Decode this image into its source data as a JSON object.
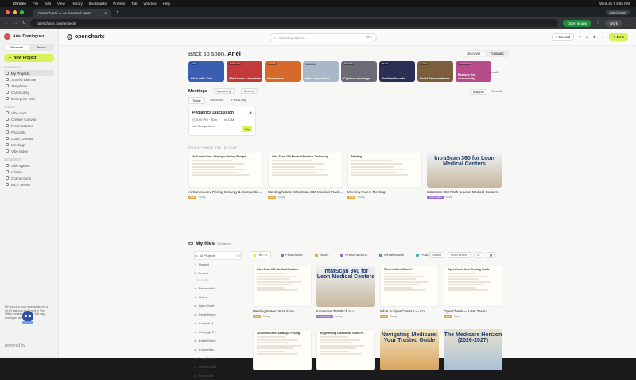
{
  "macbar": {
    "app": "Chrome",
    "menus": [
      "File",
      "Edit",
      "View",
      "History",
      "Bookmarks",
      "Profiles",
      "Tab",
      "Window",
      "Help"
    ],
    "clock": "Wed Jul 9 6:56 PM"
  },
  "browser": {
    "tab_title": "OpenCharts — AI-Powered Meeti...",
    "url": "opencharts.com/projects",
    "open_in_app": "Open in app",
    "ask": "Ask Gemini",
    "work": "Work"
  },
  "sidebar": {
    "user": "Ariel Dominguez",
    "seg": [
      "Personal",
      "Teams"
    ],
    "new_project": "New Project",
    "workspace_label": "WORKSPACE",
    "workspace": [
      "My Projects",
      "Shared with Me",
      "Templates",
      "Community",
      "Enterprise Wiki"
    ],
    "create_label": "CREATE",
    "create": [
      "Vibe docs",
      "Creator Canvas",
      "Presentations",
      "Podcasts",
      "Code Canvas",
      "Meetings",
      "Vibe Index"
    ],
    "connect_label": "GET AGENTS",
    "connect": [
      "Vibe agents",
      "Library",
      "Connections",
      "MCP Server"
    ],
    "promo": "My whack-a-mole sidebar launch at 20:00 just now as Gemini in The Office-watching Anant's 100-day developed arrived.",
    "powered": "powered by"
  },
  "topnav": {
    "logo": "opencharts",
    "search_placeholder": "Search projects...",
    "shortcut": "⌘K",
    "record": "Record",
    "new": "New"
  },
  "home": {
    "welcome_prefix": "Back so soon, ",
    "welcome_name": "Ariel",
    "discover": "Discover",
    "tutorials": "Tutorials",
    "templates": [
      {
        "label": "Chat with Tina",
        "tag": "NEW",
        "color": "#3a5fb0"
      },
      {
        "label": "Start from a template",
        "tag": "TEMPLATE",
        "color": "#c23b3b"
      },
      {
        "label": "Generate a...",
        "tag": "CREATE",
        "color": "#d76a2b"
      },
      {
        "label": "Make a podcast",
        "tag": "PODCAST",
        "color": "#a9b8c9"
      },
      {
        "label": "Capture meetings",
        "tag": "MEETING",
        "color": "#6d6a77"
      },
      {
        "label": "Build with code",
        "tag": "BUILD",
        "color": "#2a2f55"
      },
      {
        "label": "Build Presentations",
        "tag": "SLIDES",
        "color": "#7b5e3b"
      },
      {
        "label": "Explore the community",
        "tag": "COMMUNITY",
        "color": "#b84c8a"
      }
    ],
    "show_all": "Show all",
    "meetings_title": "Meetings",
    "upcoming": "Upcoming",
    "recent": "Recent",
    "meeting_tabs": [
      "Today",
      "Tomorrow",
      "Pick a day"
    ],
    "insights": "Insights",
    "view_all": "View All",
    "meeting": {
      "title": "Pediatrics Discussion",
      "time": "5:00 PM · 30m",
      "people": "In 12M",
      "source": "via Google Meet",
      "join": "Join"
    },
    "pickup": "PICK UP WHERE YOU LEFT OFF",
    "recent_cards": [
      {
        "head": "AirControl.dev: Strategic Pricing Bluepri...",
        "title": "AirControl.dev Pricing Strategy & Competitio...",
        "badge": "Note",
        "when": "Today"
      },
      {
        "head": "Intra Scan 360 Medical Practice Technolog...",
        "title": "Meeting Notes: Intra Scan 360 Medical Practi...",
        "badge": "Note",
        "when": "Today"
      },
      {
        "head": "Meeting",
        "title": "Meeting Notes: Meeting",
        "badge": "Note",
        "when": "Today"
      },
      {
        "head": "IntraScan 360 for Leon Medical Centers",
        "title": "IntraScan 360 Pitch to Leon Medical Centers",
        "badge": "Presentation",
        "when": "Today"
      }
    ]
  },
  "files": {
    "title": "My files",
    "count": "200 items",
    "tree": [
      {
        "label": "All Projects",
        "n": "200"
      },
      {
        "label": "Starred",
        "n": ""
      },
      {
        "label": "Recent",
        "n": ""
      },
      {
        "label": "FOLDERS",
        "n": ""
      },
      {
        "label": "Presentatio...",
        "n": ""
      },
      {
        "label": "Notes",
        "n": ""
      },
      {
        "label": "OpenChart...",
        "n": ""
      },
      {
        "label": "Study Notes",
        "n": ""
      },
      {
        "label": "Content M...",
        "n": ""
      },
      {
        "label": "Strategy/ P...",
        "n": ""
      },
      {
        "label": "Briefs Notes",
        "n": ""
      },
      {
        "label": "Competitiv...",
        "n": ""
      },
      {
        "label": "Script Notes",
        "n": ""
      },
      {
        "label": "Whiteboards",
        "n": ""
      },
      {
        "label": "Flowcharts",
        "n": ""
      }
    ],
    "filters": [
      {
        "label": "All",
        "n": "200",
        "c": "#d7f25a"
      },
      {
        "label": "Flowcharts",
        "n": "",
        "c": "#8a6ad8"
      },
      {
        "label": "Notes",
        "n": "",
        "c": "#e8a33c"
      },
      {
        "label": "Presentations",
        "n": "",
        "c": "#9b6ad8"
      },
      {
        "label": "Whiteboards",
        "n": "",
        "c": "#4a8fd8"
      },
      {
        "label": "Podcasts",
        "n": "3",
        "c": "#4ab0a8"
      },
      {
        "label": "Code",
        "n": "0",
        "c": "#2a9d5a"
      }
    ],
    "select": "Select",
    "sort": "Most recent",
    "grid": [
      {
        "head": "Intra Scan 360 Medical Practic...",
        "title": "Meeting Notes: Intra Scan ...",
        "badge": "Note",
        "when": "Today",
        "img": false
      },
      {
        "head": "IntraScan 360 for Leon Medical Centers",
        "title": "IntraScan 360 Pitch to L...",
        "badge": "Presentation",
        "when": "Today",
        "img": true
      },
      {
        "head": "What is OpenCharts?",
        "title": "What is OpenCharts? — Co...",
        "badge": "Note",
        "when": "Today",
        "img": false
      },
      {
        "head": "OpenCharts User Testing Guide",
        "title": "OpenCharts — User Testin...",
        "badge": "Note",
        "when": "Today",
        "img": false
      },
      {
        "head": "AirControl.dev: Strategic Pricing",
        "title": "",
        "badge": "",
        "when": "",
        "img": false
      },
      {
        "head": "Engineering Discourse: North P...",
        "title": "",
        "badge": "",
        "when": "",
        "img": false
      },
      {
        "head": "Navigating Medicare: Your Trusted Guide",
        "title": "",
        "badge": "",
        "when": "",
        "img": true
      },
      {
        "head": "The Medicare Horizon (2026-2027)",
        "title": "",
        "badge": "",
        "when": "",
        "img": true
      }
    ]
  }
}
